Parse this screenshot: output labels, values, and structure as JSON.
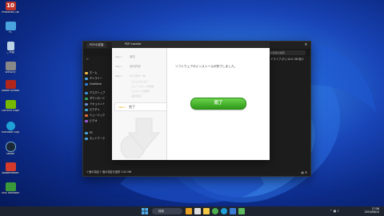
{
  "desktop": {
    "icons": [
      {
        "label": "PMBlanks Collection",
        "icon": "app-red-icon",
        "color": "#c0352b"
      },
      {
        "label": "PC",
        "icon": "monitor-icon",
        "color": "#4aa3df"
      },
      {
        "label": "ごみ箱",
        "icon": "recycle-bin-icon",
        "color": "#bcd3e6"
      },
      {
        "label": "WinScry",
        "icon": "app-icon",
        "color": "#888888"
      },
      {
        "label": "Adobe Acrobat 7.0 Professional",
        "icon": "acrobat-icon",
        "color": "#b0261d"
      },
      {
        "label": "GeForce Experience",
        "icon": "nvidia-icon",
        "color": "#76b900"
      },
      {
        "label": "Microsoft Edge",
        "icon": "edge-icon",
        "color": "#1fa1d8"
      },
      {
        "label": "Steam",
        "icon": "steam-icon",
        "color": "#1b2838"
      },
      {
        "label": "AdobeReader",
        "icon": "adobe-reader-icon",
        "color": "#d33a2c"
      },
      {
        "label": "SMS Hardware",
        "icon": "app-green-icon",
        "color": "#3a9a3a"
      }
    ]
  },
  "explorer": {
    "tab_label": "PDFの変換",
    "path": "ドライブ (E:) 10.0 GB 個人",
    "search_placeholder": "PDFの変換の検索",
    "sidebar": [
      "ホーム",
      "ギャラリー",
      "OneDrive",
      "デスクトップ",
      "ダウンロード",
      "ドキュメント",
      "ピクチャ",
      "ミュージック",
      "ビデオ",
      "PC",
      "ネットワーク"
    ],
    "status": "1 個の項目  1 個の項目を選択 3.62 MB"
  },
  "installer": {
    "title": "PDF Installer",
    "steps": [
      {
        "num": "Step 1",
        "label": "確認"
      },
      {
        "num": "Step 2",
        "label": "使用許諾"
      },
      {
        "num": "Step 3",
        "label": "インストール"
      }
    ],
    "substeps": [
      "ファイルのコピー",
      "ショートカットの作成",
      "レジストリの登録",
      "設定の完了"
    ],
    "done_step": {
      "num": "Step 4",
      "label": "完了"
    },
    "message": "ソフトウェアのインストールが完了しました。",
    "finish_button": "完了"
  },
  "taskbar": {
    "search_label": "検索",
    "time": "17:56",
    "date": "2024/06/14",
    "apps": [
      {
        "icon": "widgets-icon",
        "color": "#e8a020"
      },
      {
        "icon": "task-view-icon",
        "color": "#dddddd"
      },
      {
        "icon": "file-explorer-icon",
        "color": "#f2c744"
      },
      {
        "icon": "chrome-icon",
        "color": "#4caf50"
      },
      {
        "icon": "edge-icon",
        "color": "#1fa1d8"
      },
      {
        "icon": "store-icon",
        "color": "#3a7bd5"
      },
      {
        "icon": "installer-app-icon",
        "color": "#5cb85c"
      }
    ]
  }
}
